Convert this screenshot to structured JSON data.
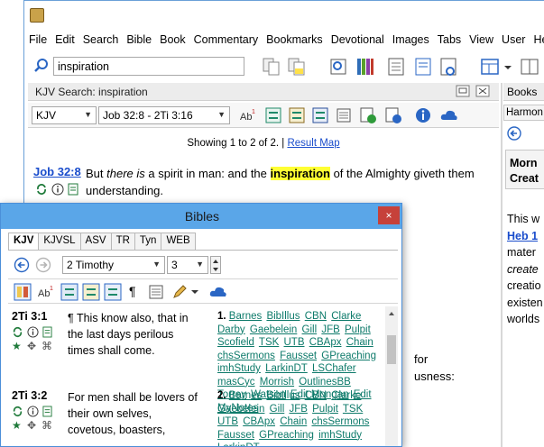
{
  "main": {
    "menu": [
      "File",
      "Edit",
      "Search",
      "Bible",
      "Book",
      "Commentary",
      "Bookmarks",
      "Devotional",
      "Images",
      "Tabs",
      "View",
      "User",
      "He"
    ],
    "search_value": "inspiration",
    "search_panel": {
      "title": "KJV Search: inspiration",
      "version": "KJV",
      "range": "Job 32:8 - 2Ti 3:16",
      "showing": "Showing 1 to 2 of 2. |",
      "result_map": "Result Map",
      "result_ref": "Job 32:8",
      "result_pre": "But ",
      "result_italic": "there is",
      "result_mid": " a spirit in man: and the ",
      "result_highlight": "inspiration",
      "result_post": " of the Almighty giveth them understanding.",
      "partial_1": "for",
      "partial_2": "usness:"
    },
    "right_panel": {
      "header": "Books",
      "tab": "Harmon",
      "title_line1": "Morn",
      "title_line2": "Creat",
      "body_line1": "This w",
      "body_link": "Heb 1",
      "body_line3": "mater",
      "body_line4": "create",
      "body_line5": "creatio",
      "body_line6": "existen",
      "body_line7": "worlds"
    }
  },
  "bibles": {
    "title": "Bibles",
    "close": "×",
    "tabs": [
      "KJV",
      "KJVSL",
      "ASV",
      "TR",
      "Tyn",
      "WEB"
    ],
    "book": "2 Timothy",
    "chapter": "3",
    "verses": [
      {
        "ref": "2Ti 3:1",
        "text_line1": "¶ This know also, that in",
        "text_line2": "the last days perilous",
        "text_line3": "times shall come.",
        "num": "1.",
        "links": [
          "Barnes",
          "BibIllus",
          "CBN",
          "Clarke",
          "Darby",
          "Gaebelein",
          "Gill",
          "JFB",
          "Pulpit",
          "Scofield",
          "TSK",
          "UTB",
          "CBApx",
          "Chain",
          "chsSermons",
          "Fausset",
          "GPreaching",
          "imhStudy",
          "LarkinDT",
          "LSChafer",
          "masCyc",
          "Morrish",
          "OutlinesBB",
          "Torrey",
          "Watson",
          "Edit Mongan",
          "Edit MyNotes"
        ]
      },
      {
        "ref": "2Ti 3:2",
        "text_line1": "For men shall be lovers of",
        "text_line2": "their own selves,",
        "text_line3": "covetous, boasters,",
        "num": "2.",
        "links": [
          "Barnes",
          "BibIllus",
          "CBN",
          "Clarke",
          "Gaebelein",
          "Gill",
          "JFB",
          "Pulpit",
          "TSK",
          "UTB",
          "CBApx",
          "Chain",
          "chsSermons",
          "Fausset",
          "GPreaching",
          "imhStudy",
          "LarkinDT"
        ]
      }
    ]
  }
}
